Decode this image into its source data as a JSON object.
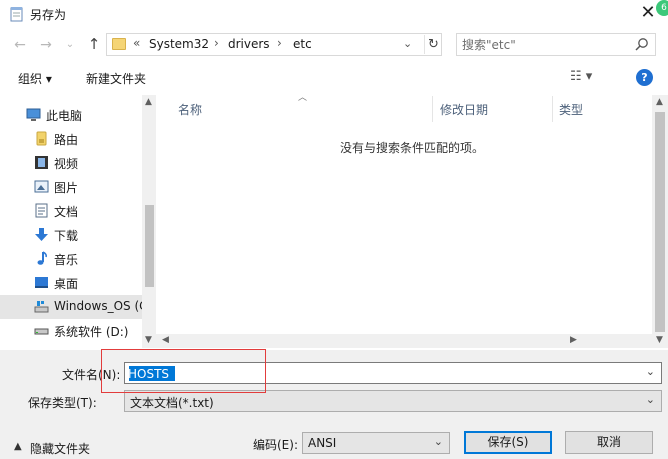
{
  "window": {
    "title": "另存为",
    "badge": "6"
  },
  "nav": {
    "breadcrumb": [
      "«",
      "System32",
      "drivers",
      "etc"
    ],
    "search_placeholder": "搜索\"etc\""
  },
  "toolbar": {
    "organize": "组织 ▾",
    "new_folder": "新建文件夹",
    "view": "☷ ▾",
    "help": "?"
  },
  "sidebar": {
    "items": [
      {
        "label": "此电脑",
        "icon": "computer-icon"
      },
      {
        "label": "路由",
        "icon": "router-icon"
      },
      {
        "label": "视频",
        "icon": "video-icon"
      },
      {
        "label": "图片",
        "icon": "pictures-icon"
      },
      {
        "label": "文档",
        "icon": "documents-icon"
      },
      {
        "label": "下载",
        "icon": "download-icon"
      },
      {
        "label": "音乐",
        "icon": "music-icon"
      },
      {
        "label": "桌面",
        "icon": "desktop-icon"
      },
      {
        "label": "Windows_OS (C",
        "icon": "drive-icon",
        "selected": true
      },
      {
        "label": "系统软件 (D:)",
        "icon": "drive-icon"
      }
    ]
  },
  "list": {
    "columns": [
      "名称",
      "修改日期",
      "类型"
    ],
    "empty_message": "没有与搜索条件匹配的项。"
  },
  "bottom": {
    "filename_label": "文件名(N):",
    "filename_value": "HOSTS",
    "filetype_label": "保存类型(T):",
    "filetype_value": "文本文档(*.txt)",
    "encoding_label": "编码(E):",
    "encoding_value": "ANSI",
    "save": "保存(S)",
    "cancel": "取消",
    "hide_folders": "隐藏文件夹"
  },
  "colors": {
    "accent": "#0078d7",
    "highlight_box": "#e23c3c"
  }
}
